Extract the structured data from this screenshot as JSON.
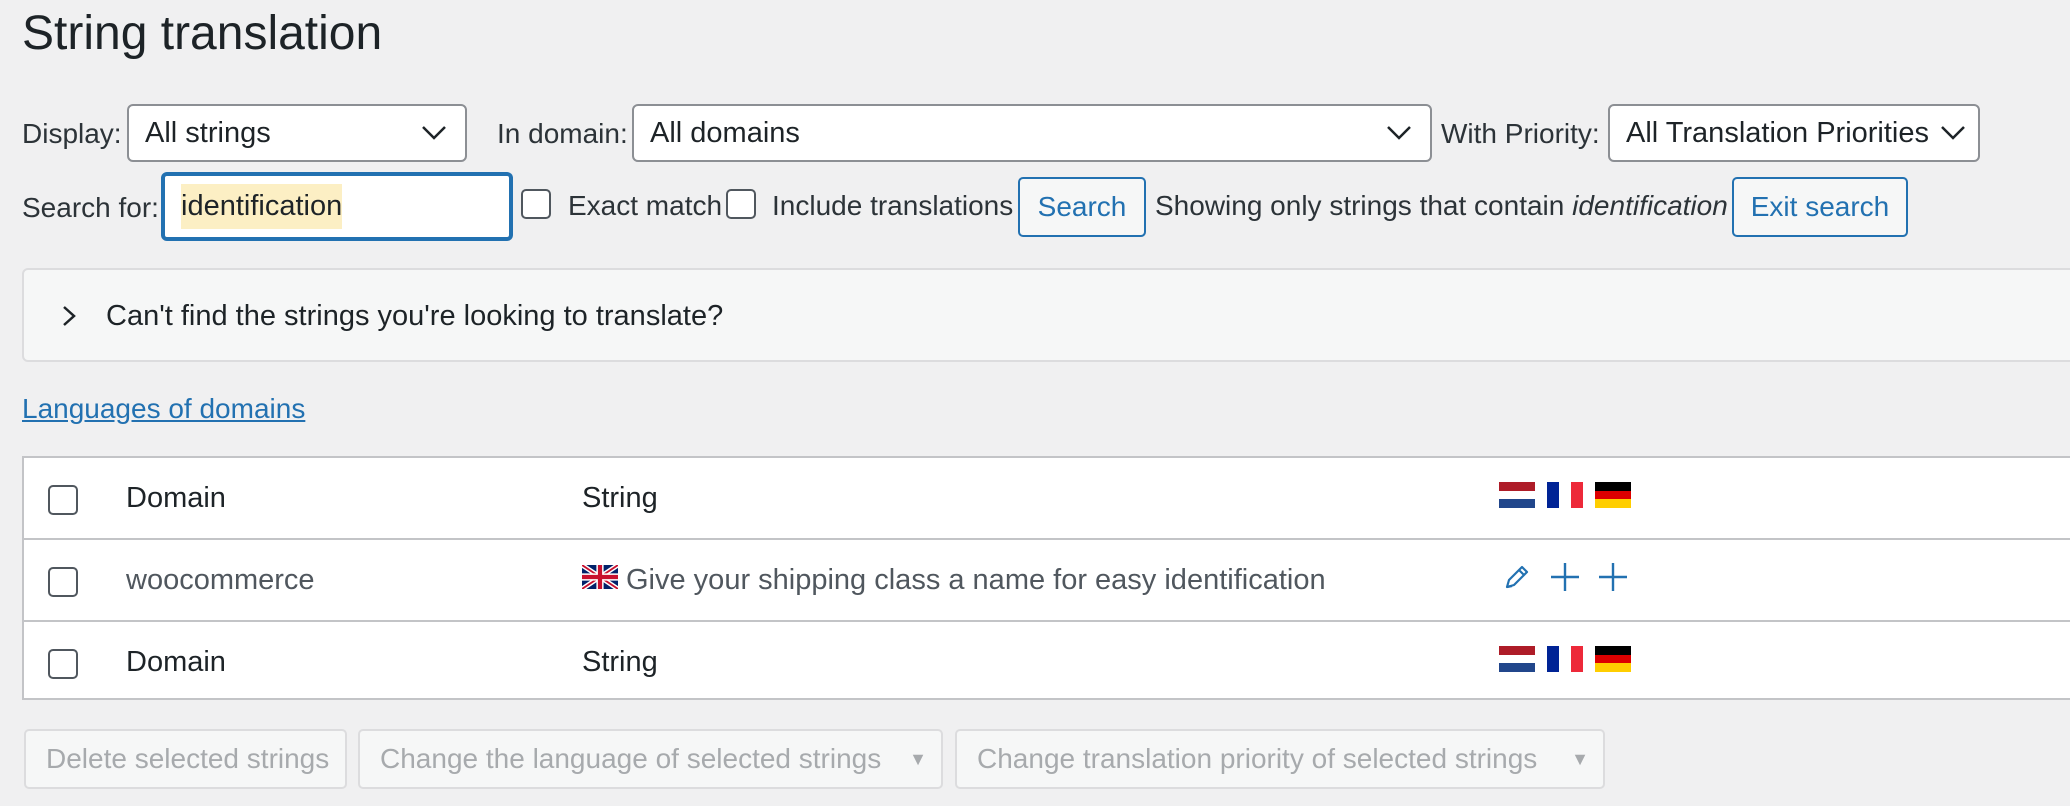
{
  "page": {
    "title": "String translation"
  },
  "filters": {
    "display_label": "Display:",
    "display_value": "All strings",
    "domain_label": "In domain:",
    "domain_value": "All domains",
    "priority_label": "With Priority:",
    "priority_value": "All Translation Priorities"
  },
  "search": {
    "label": "Search for:",
    "value": "identification",
    "exact_match_label": "Exact match",
    "include_translations_label": "Include translations",
    "search_button": "Search",
    "showing_prefix": "Showing only strings that contain",
    "showing_term": "identification",
    "exit_button": "Exit search"
  },
  "notice": {
    "text": "Can't find the strings you're looking to translate?"
  },
  "languages_link": "Languages of domains",
  "table": {
    "header": {
      "domain": "Domain",
      "string": "String"
    },
    "flags": [
      "nl-flag-icon",
      "fr-flag-icon",
      "de-flag-icon"
    ],
    "rows": [
      {
        "domain": "woocommerce",
        "string": "Give your shipping class a name for easy identification",
        "source_flag": "gb-flag-icon",
        "actions": [
          "edit-pencil-icon",
          "add-plus-icon",
          "add-plus-icon"
        ]
      }
    ],
    "footer": {
      "domain": "Domain",
      "string": "String"
    }
  },
  "bulk_actions": {
    "delete": "Delete selected strings",
    "change_language": "Change the language of selected strings",
    "change_priority": "Change translation priority of selected strings"
  },
  "colors": {
    "accent": "#2271b1",
    "background": "#f0f0f1",
    "highlight": "#fcefc4"
  }
}
